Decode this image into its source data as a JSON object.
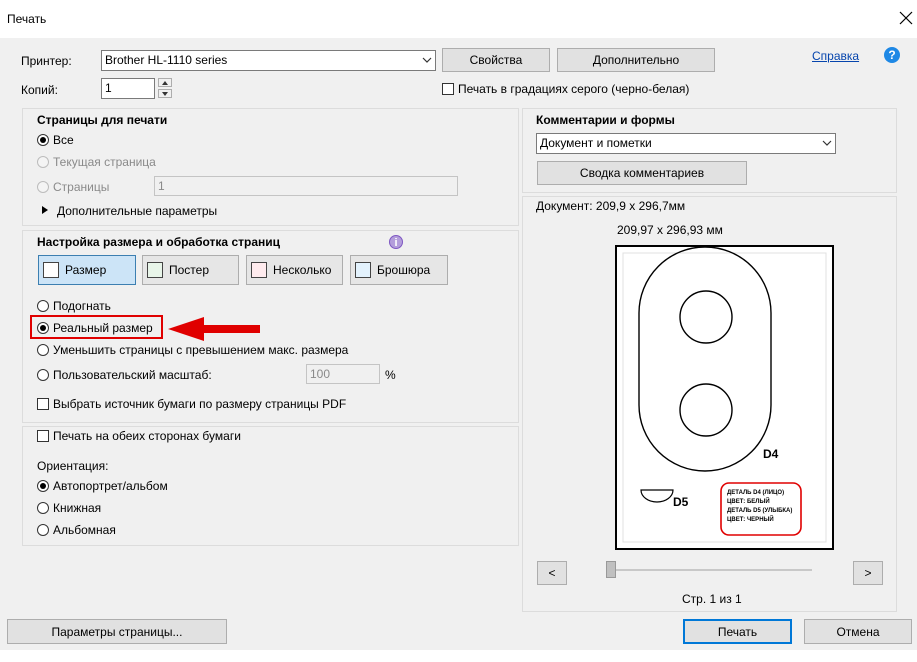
{
  "window": {
    "title": "Печать"
  },
  "printer": {
    "label": "Принтер:",
    "selected": "Brother HL-1110 series",
    "properties_button": "Свойства",
    "advanced_button": "Дополнительно",
    "help_link": "Справка",
    "help_icon_char": "?"
  },
  "copies": {
    "label": "Копий:",
    "value": "1"
  },
  "grayscale": {
    "label": "Печать в градациях серого (черно-белая)",
    "checked": false
  },
  "pages": {
    "title": "Страницы для печати",
    "all": "Все",
    "current": "Текущая страница",
    "range": "Страницы",
    "range_value": "1",
    "more": "Дополнительные параметры"
  },
  "sizing": {
    "title": "Настройка размера и обработка страниц",
    "info_char": "i",
    "tabs": [
      {
        "label": "Размер",
        "selected": true
      },
      {
        "label": "Постер",
        "selected": false
      },
      {
        "label": "Несколько",
        "selected": false
      },
      {
        "label": "Брошюра",
        "selected": false
      }
    ],
    "fit": "Подогнать",
    "actual": "Реальный размер",
    "shrink": "Уменьшить страницы с превышением макс. размера",
    "custom": "Пользовательский масштаб:",
    "custom_value": "100",
    "percent": "%",
    "paper_source": "Выбрать источник бумаги по размеру страницы PDF"
  },
  "duplex": {
    "label": "Печать на обеих сторонах бумаги"
  },
  "orientation": {
    "title": "Ориентация:",
    "auto": "Автопортрет/альбом",
    "portrait": "Книжная",
    "landscape": "Альбомная"
  },
  "comments": {
    "title": "Комментарии и формы",
    "selected": "Документ и пометки",
    "summary_button": "Сводка комментариев"
  },
  "preview": {
    "doc_size": "Документ: 209,9 x 296,7мм",
    "page_size": "209,97 x 296,93 мм",
    "label_d4": "D4",
    "label_d5": "D5",
    "note_lines": [
      "ДЕТАЛЬ D4 (ЛИЦО)",
      "ЦВЕТ: БЕЛЫЙ",
      "ДЕТАЛЬ D5 (УЛЫБКА)",
      "ЦВЕТ: ЧЕРНЫЙ"
    ],
    "prev": "<",
    "next": ">",
    "page_counter": "Стр. 1 из 1",
    "slider_fraction": 0
  },
  "footer": {
    "page_setup": "Параметры страницы...",
    "print": "Печать",
    "cancel": "Отмена"
  },
  "colors": {
    "accent": "#0078d7",
    "annotation": "#e00000",
    "link": "#0645ad"
  }
}
